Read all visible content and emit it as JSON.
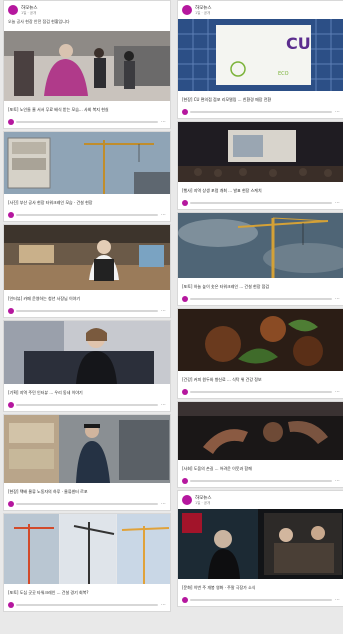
{
  "feed": {
    "left": [
      {
        "has_header": true,
        "intro": "오늘 공사 현장 안전 점검 현황입니다",
        "caption": "[포토] 노인들 줄 서서 무료 배식 받는 모습... 사회 복지 현실",
        "scene": "elderly"
      },
      {
        "has_header": false,
        "caption": "[사진] 부산 공사 현장 타워크레인 모습 · 건설 현장",
        "scene": "cranes_sky"
      },
      {
        "has_header": false,
        "caption": "[인터뷰] 카페 운영하는 청년 사장님 이야기",
        "scene": "cafe"
      },
      {
        "has_header": false,
        "caption": "[기획] 지역 주민 인터뷰 ... 우리 동네 이야기",
        "scene": "woman"
      },
      {
        "has_header": false,
        "caption": "[현장] 택배 물류 노동자의 하루 · 물류센터 르포",
        "scene": "worker"
      },
      {
        "has_header": false,
        "caption": "[포토] 도심 곳곳 타워크레인 ... 건설 경기 회복?",
        "scene": "triple_cranes"
      }
    ],
    "right": [
      {
        "has_header": true,
        "intro": "",
        "caption": "[현장] CU 편의점 점포 리모델링 ... 친환경 매장 전환",
        "scene": "cu_sign"
      },
      {
        "has_header": false,
        "caption": "[행사] 지역 상생 포럼 개최 ... 발표 현장 스케치",
        "scene": "conference"
      },
      {
        "has_header": false,
        "caption": "[포토] 하늘 높이 솟은 타워크레인 ... 건설 현장 점검",
        "scene": "crane_cloud"
      },
      {
        "has_header": false,
        "caption": "[건강] 커피 원두와 향신료 ... 식탁 위 건강 정보",
        "scene": "coffee"
      },
      {
        "has_header": false,
        "caption": "[사회] 도움의 손길 ... 어려운 이웃과 함께",
        "scene": "hands"
      },
      {
        "has_header": true,
        "intro": "",
        "caption": "[문화] 이번 주 개봉 영화 · 주말 극장가 소식",
        "scene": "poster"
      }
    ]
  },
  "channel": {
    "name": "하모뉴스",
    "sub": "1일 · 공개",
    "brand_color": "#b5179e"
  },
  "cu_sign_text": "CU",
  "cu_label": "ECO"
}
